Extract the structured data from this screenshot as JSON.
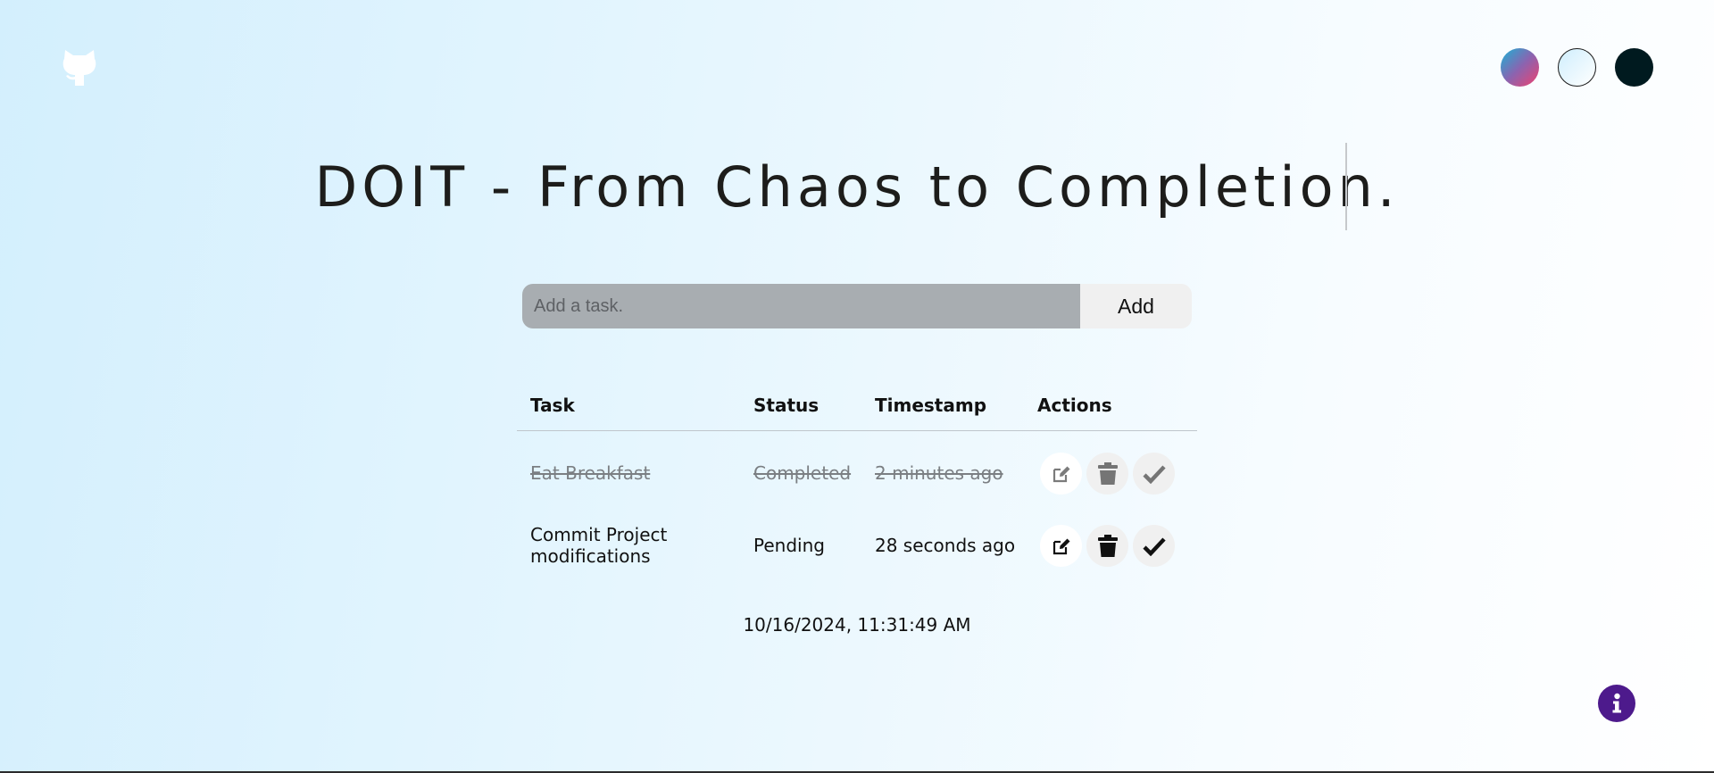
{
  "app": {
    "title": "DOIT - From Chaos to Completion."
  },
  "header": {
    "github_icon": "github-icon",
    "themes": [
      {
        "name": "gradient",
        "color": "#f0416e"
      },
      {
        "name": "light",
        "color": "#ffffff"
      },
      {
        "name": "dark",
        "color": "#001a1f"
      }
    ]
  },
  "form": {
    "placeholder": "Add a task.",
    "value": "",
    "add_label": "Add"
  },
  "table": {
    "headers": [
      "Task",
      "Status",
      "Timestamp",
      "Actions"
    ],
    "rows": [
      {
        "task": "Eat Breakfast",
        "status": "Completed",
        "timestamp": "2 minutes ago",
        "completed": true
      },
      {
        "task": "Commit Project modifications",
        "status": "Pending",
        "timestamp": "28 seconds ago",
        "completed": false
      }
    ]
  },
  "footer": {
    "datetime": "10/16/2024, 11:31:49 AM"
  },
  "info": {
    "icon": "info-icon",
    "color": "#4d1a8c"
  }
}
